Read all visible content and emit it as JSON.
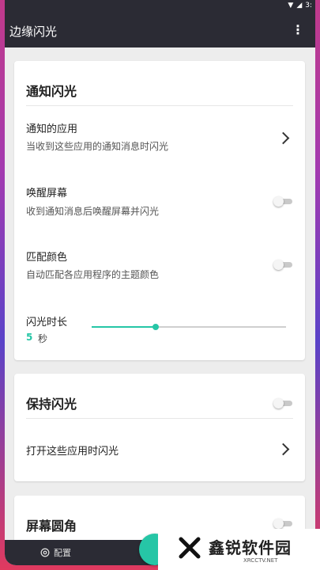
{
  "app": {
    "title": "边缘闪光"
  },
  "status_bar": {
    "time": "3:"
  },
  "cards": {
    "notify": {
      "title": "通知闪光",
      "apps_title": "通知的应用",
      "apps_sub": "当收到这些应用的通知消息时闪光",
      "wake_title": "唤醒屏幕",
      "wake_sub": "收到通知消息后唤醒屏幕并闪光",
      "match_title": "匹配颜色",
      "match_sub": "自动匹配各应用程序的主题颜色",
      "duration_title": "闪光时长",
      "duration_value": "5",
      "duration_unit": "秒",
      "duration_slider_fraction": 0.33,
      "wake_enabled": false,
      "match_enabled": false
    },
    "keep": {
      "title": "保持闪光",
      "open_apps_label": "打开这些应用时闪光",
      "enabled": false
    },
    "corner": {
      "title": "屏幕圆角",
      "enabled": false
    }
  },
  "bottom_nav": {
    "config_label": "配置"
  },
  "watermark": {
    "brand": "鑫锐软件园",
    "site": "XRCCTV.NET"
  },
  "colors": {
    "accent": "#26c6a6",
    "appbar": "#2b2b34"
  }
}
